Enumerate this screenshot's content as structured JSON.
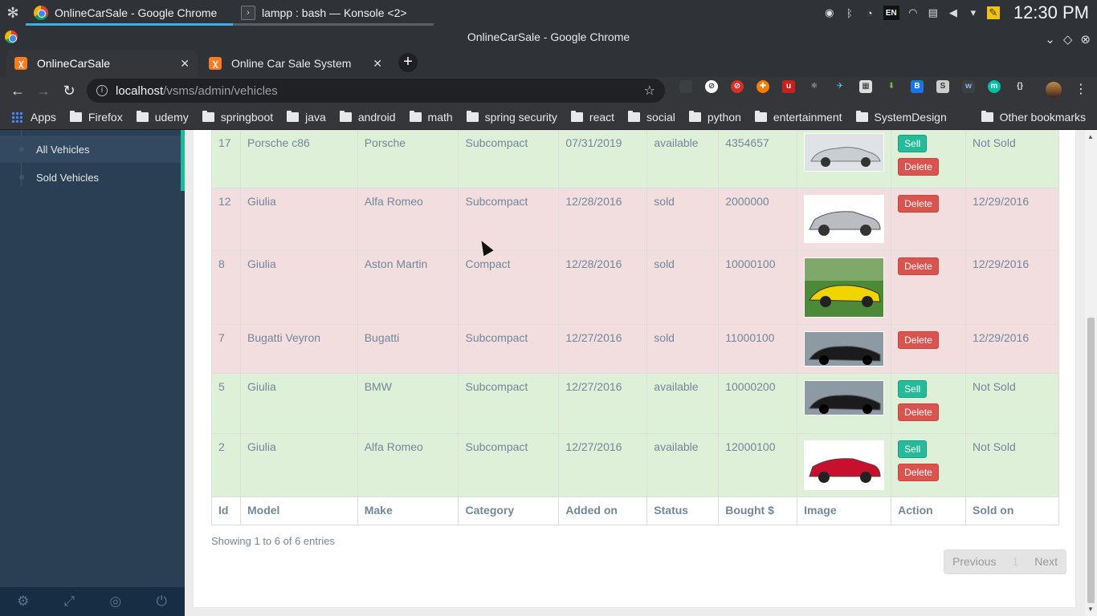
{
  "taskbar": {
    "tasks": [
      {
        "label": "OnlineCarSale - Google Chrome"
      },
      {
        "label": "lampp : bash — Konsole <2>"
      }
    ],
    "keyboard_layout": "EN",
    "clock": "12:30 PM"
  },
  "window": {
    "title": "OnlineCarSale - Google Chrome"
  },
  "tabs": [
    {
      "label": "OnlineCarSale",
      "active": true
    },
    {
      "label": "Online Car Sale System",
      "active": false
    }
  ],
  "omnibox": {
    "host": "localhost",
    "path": "/vsms/admin/vehicles"
  },
  "bookmarks": {
    "apps_label": "Apps",
    "items": [
      "Firefox",
      "udemy",
      "springboot",
      "java",
      "android",
      "math",
      "spring security",
      "react",
      "social",
      "python",
      "entertainment",
      "SystemDesign"
    ],
    "other": "Other bookmarks"
  },
  "sidebar": {
    "items": [
      {
        "label": "All Vehicles",
        "active": true
      },
      {
        "label": "Sold Vehicles",
        "active": false
      }
    ]
  },
  "table": {
    "columns": [
      "Id",
      "Model",
      "Make",
      "Category",
      "Added on",
      "Status",
      "Bought $",
      "Image",
      "Action",
      "Sold on"
    ],
    "rows": [
      {
        "id": "17",
        "model": "Porsche c86",
        "make": "Porsche",
        "category": "Subcompact",
        "added_on": "07/31/2019",
        "status": "available",
        "bought": "4354657",
        "image": "silver-classic-roadster",
        "sold_on": "Not Sold"
      },
      {
        "id": "12",
        "model": "Giulia",
        "make": "Alfa Romeo",
        "category": "Subcompact",
        "added_on": "12/28/2016",
        "status": "sold",
        "bought": "2000000",
        "image": "silver-suv-wagon",
        "sold_on": "12/29/2016"
      },
      {
        "id": "8",
        "model": "Giulia",
        "make": "Aston Martin",
        "category": "Compact",
        "added_on": "12/28/2016",
        "status": "sold",
        "bought": "10000100",
        "image": "yellow-sports-car",
        "sold_on": "12/29/2016"
      },
      {
        "id": "7",
        "model": "Bugatti Veyron",
        "make": "Bugatti",
        "category": "Subcompact",
        "added_on": "12/27/2016",
        "status": "sold",
        "bought": "11000100",
        "image": "black-hypercar",
        "sold_on": "12/29/2016"
      },
      {
        "id": "5",
        "model": "Giulia",
        "make": "BMW",
        "category": "Subcompact",
        "added_on": "12/27/2016",
        "status": "available",
        "bought": "10000200",
        "image": "black-hypercar",
        "sold_on": "Not Sold"
      },
      {
        "id": "2",
        "model": "Giulia",
        "make": "Alfa Romeo",
        "category": "Subcompact",
        "added_on": "12/27/2016",
        "status": "available",
        "bought": "12000100",
        "image": "red-sedan",
        "sold_on": "Not Sold"
      }
    ],
    "sell_label": "Sell",
    "delete_label": "Delete"
  },
  "info": "Showing 1 to 6 of 6 entries",
  "pagination": {
    "previous": "Previous",
    "page": "1",
    "next": "Next"
  },
  "colors": {
    "available_row": "#dff0d8",
    "sold_row": "#f2dede",
    "sidebar_bg": "#2a3f54",
    "accent": "#1abb9c"
  }
}
